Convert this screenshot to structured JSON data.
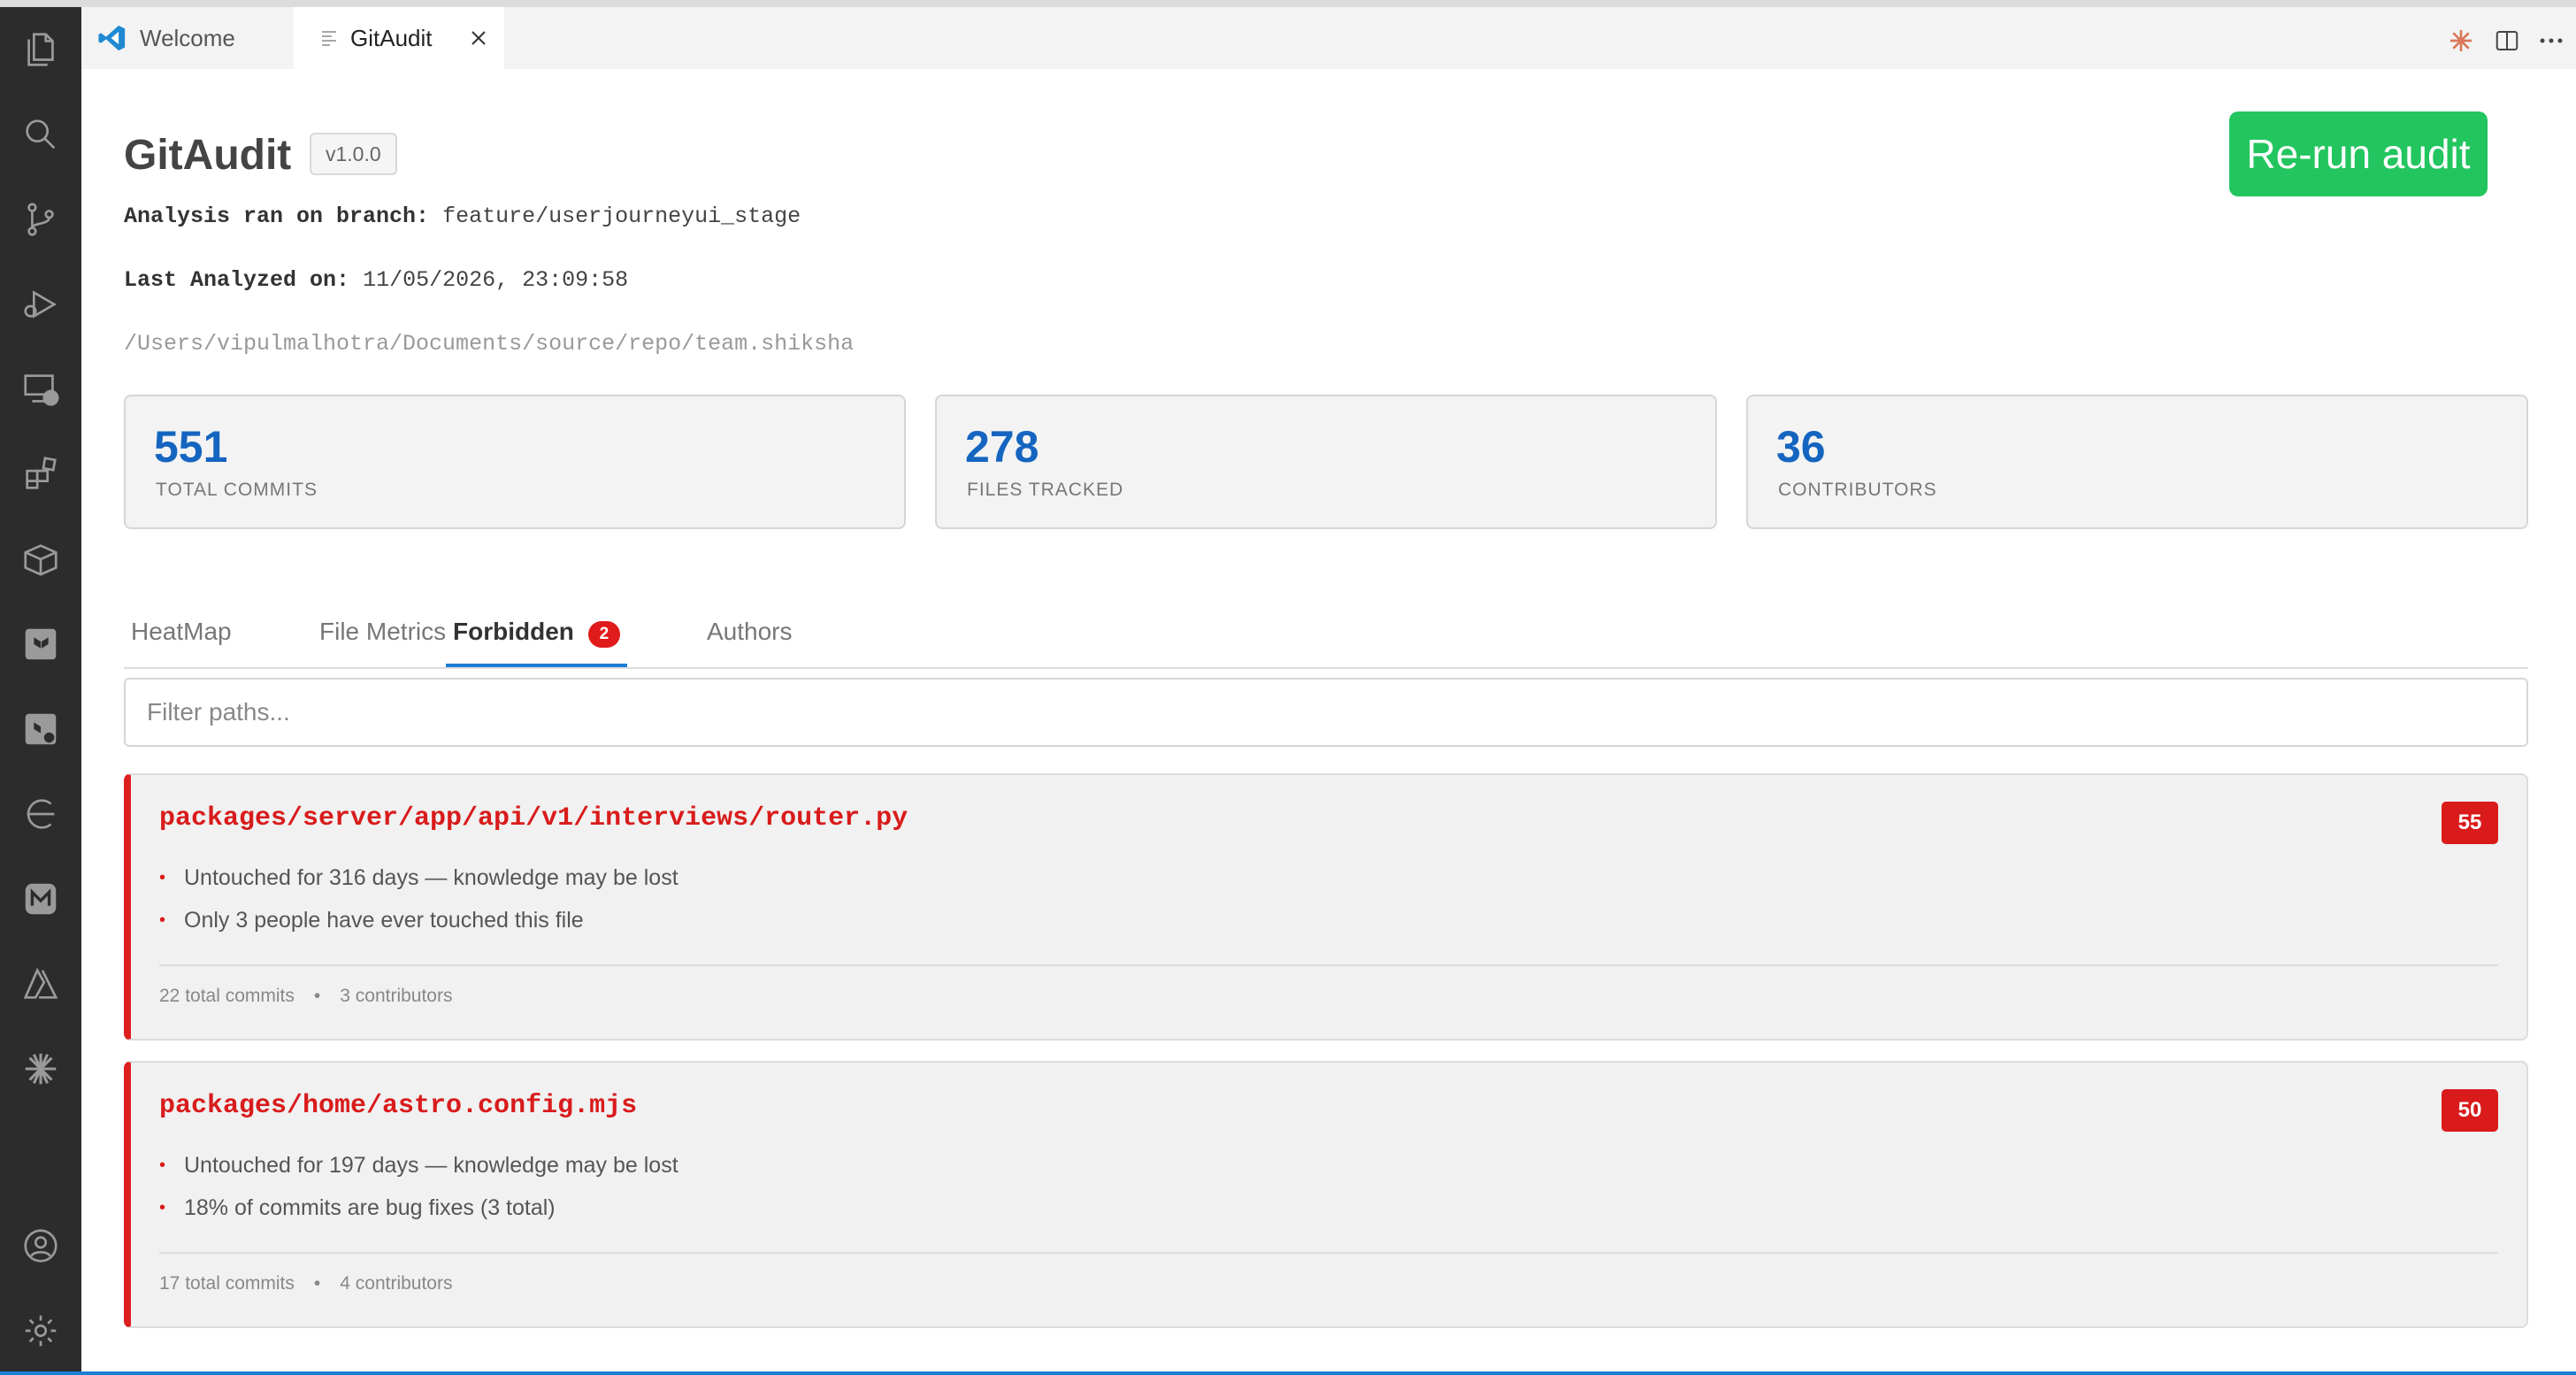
{
  "editor_tabs": [
    {
      "label": "Welcome"
    },
    {
      "label": "GitAudit"
    }
  ],
  "header": {
    "title": "GitAudit",
    "version": "v1.0.0",
    "rerun_label": "Re-run audit",
    "branch_label": "Analysis ran on branch:",
    "branch_value": "feature/userjourneyui_stage",
    "analyzed_label": "Last Analyzed on:",
    "analyzed_value": "11/05/2026, 23:09:58",
    "repo_path": "/Users/vipulmalhotra/Documents/source/repo/team.shiksha"
  },
  "stats": [
    {
      "value": "551",
      "label": "TOTAL COMMITS"
    },
    {
      "value": "278",
      "label": "FILES TRACKED"
    },
    {
      "value": "36",
      "label": "CONTRIBUTORS"
    }
  ],
  "view_tabs": [
    {
      "label": "HeatMap"
    },
    {
      "label": "File Metrics"
    },
    {
      "label": "Forbidden",
      "badge": "2",
      "active": true
    },
    {
      "label": "Authors"
    }
  ],
  "filter": {
    "placeholder": "Filter paths...",
    "value": ""
  },
  "files": [
    {
      "path": "packages/server/app/api/v1/interviews/router.py",
      "score": "55",
      "reasons": [
        "Untouched for 316 days — knowledge may be lost",
        "Only 3 people have ever touched this file"
      ],
      "commits": "22 total commits",
      "contributors": "3 contributors"
    },
    {
      "path": "packages/home/astro.config.mjs",
      "score": "50",
      "reasons": [
        "Untouched for 197 days — knowledge may be lost",
        "18% of commits are bug fixes (3 total)"
      ],
      "commits": "17 total commits",
      "contributors": "4 contributors"
    }
  ],
  "colors": {
    "accent": "#1c7ed6",
    "danger": "#d91b1b",
    "success": "#22c55e",
    "stat_number": "#1565c0"
  },
  "icons": [
    "explorer-icon",
    "search-icon",
    "source-control-icon",
    "run-debug-icon",
    "remote-explorer-icon",
    "extensions-icon",
    "containers-icon",
    "terraform-icon",
    "terraform-cloud-icon",
    "gitlens-icon",
    "minimal-icon",
    "azure-icon",
    "claude-icon",
    "account-icon",
    "settings-gear-icon"
  ]
}
